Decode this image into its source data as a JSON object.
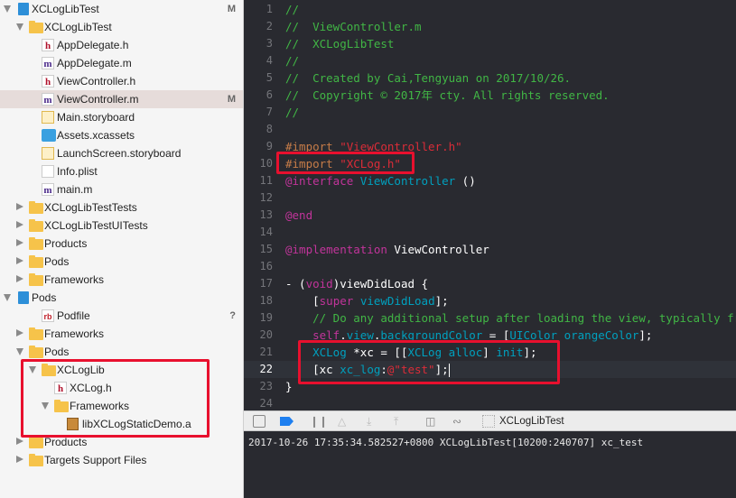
{
  "navigator": {
    "items": [
      {
        "label": "XCLogLibTest",
        "level": 0,
        "arrow": "open",
        "icon": "project",
        "badge": "M"
      },
      {
        "label": "XCLogLibTest",
        "level": 1,
        "arrow": "open",
        "icon": "folder"
      },
      {
        "label": "AppDelegate.h",
        "level": 2,
        "icon": "h"
      },
      {
        "label": "AppDelegate.m",
        "level": 2,
        "icon": "m"
      },
      {
        "label": "ViewController.h",
        "level": 2,
        "icon": "h"
      },
      {
        "label": "ViewController.m",
        "level": 2,
        "icon": "m",
        "badge": "M",
        "selected": true
      },
      {
        "label": "Main.storyboard",
        "level": 2,
        "icon": "storyboard"
      },
      {
        "label": "Assets.xcassets",
        "level": 2,
        "icon": "assets"
      },
      {
        "label": "LaunchScreen.storyboard",
        "level": 2,
        "icon": "storyboard"
      },
      {
        "label": "Info.plist",
        "level": 2,
        "icon": "plist"
      },
      {
        "label": "main.m",
        "level": 2,
        "icon": "m"
      },
      {
        "label": "XCLogLibTestTests",
        "level": 1,
        "arrow": "closed",
        "icon": "folder"
      },
      {
        "label": "XCLogLibTestUITests",
        "level": 1,
        "arrow": "closed",
        "icon": "folder"
      },
      {
        "label": "Products",
        "level": 1,
        "arrow": "closed",
        "icon": "folder"
      },
      {
        "label": "Pods",
        "level": 1,
        "arrow": "closed",
        "icon": "folder"
      },
      {
        "label": "Frameworks",
        "level": 1,
        "arrow": "closed",
        "icon": "folder"
      },
      {
        "label": "Pods",
        "level": 0,
        "arrow": "open",
        "icon": "project"
      },
      {
        "label": "Podfile",
        "level": 2,
        "icon": "ruby",
        "badge": "?"
      },
      {
        "label": "Frameworks",
        "level": 1,
        "arrow": "closed",
        "icon": "folder"
      },
      {
        "label": "Pods",
        "level": 1,
        "arrow": "open",
        "icon": "folder"
      },
      {
        "label": "XCLogLib",
        "level": 2,
        "arrow": "open",
        "icon": "folder"
      },
      {
        "label": "XCLog.h",
        "level": 3,
        "icon": "h"
      },
      {
        "label": "Frameworks",
        "level": 3,
        "arrow": "open",
        "icon": "folder"
      },
      {
        "label": "libXCLogStaticDemo.a",
        "level": 4,
        "icon": "library"
      },
      {
        "label": "Products",
        "level": 1,
        "arrow": "closed",
        "icon": "folder"
      },
      {
        "label": "Targets Support Files",
        "level": 1,
        "arrow": "closed",
        "icon": "folder"
      }
    ]
  },
  "editor": {
    "current_line": 22,
    "lines": [
      [
        [
          "comment",
          "//"
        ]
      ],
      [
        [
          "comment",
          "//  ViewController.m"
        ]
      ],
      [
        [
          "comment",
          "//  XCLogLibTest"
        ]
      ],
      [
        [
          "comment",
          "//"
        ]
      ],
      [
        [
          "comment",
          "//  Created by Cai,Tengyuan on 2017/10/26."
        ]
      ],
      [
        [
          "comment",
          "//  Copyright © 2017年 cty. All rights reserved."
        ]
      ],
      [
        [
          "comment",
          "//"
        ]
      ],
      [],
      [
        [
          "pre",
          "#import "
        ],
        [
          "str",
          "\"ViewController.h\""
        ]
      ],
      [
        [
          "pre",
          "#import "
        ],
        [
          "str",
          "\"XCLog.h\""
        ]
      ],
      [
        [
          "kw",
          "@interface "
        ],
        [
          "cls",
          "ViewController"
        ],
        [
          "plain",
          " ()"
        ]
      ],
      [],
      [
        [
          "kw",
          "@end"
        ]
      ],
      [],
      [
        [
          "kw",
          "@implementation "
        ],
        [
          "plain",
          "ViewController"
        ]
      ],
      [],
      [
        [
          "plain",
          "- ("
        ],
        [
          "kw",
          "void"
        ],
        [
          "plain",
          ")viewDidLoad {"
        ]
      ],
      [
        [
          "plain",
          "    ["
        ],
        [
          "kw",
          "super"
        ],
        [
          "plain",
          " "
        ],
        [
          "meth",
          "viewDidLoad"
        ],
        [
          "plain",
          "];"
        ]
      ],
      [
        [
          "comment",
          "    // Do any additional setup after loading the view, typically from a nib."
        ]
      ],
      [
        [
          "plain",
          "    "
        ],
        [
          "kw",
          "self"
        ],
        [
          "plain",
          "."
        ],
        [
          "meth",
          "view"
        ],
        [
          "plain",
          "."
        ],
        [
          "meth",
          "backgroundColor"
        ],
        [
          "plain",
          " = ["
        ],
        [
          "cls",
          "UIColor"
        ],
        [
          "plain",
          " "
        ],
        [
          "meth",
          "orangeColor"
        ],
        [
          "plain",
          "];"
        ]
      ],
      [
        [
          "plain",
          "    "
        ],
        [
          "cls",
          "XCLog"
        ],
        [
          "plain",
          " *xc = [["
        ],
        [
          "cls",
          "XCLog"
        ],
        [
          "plain",
          " "
        ],
        [
          "meth",
          "alloc"
        ],
        [
          "plain",
          "] "
        ],
        [
          "meth",
          "init"
        ],
        [
          "plain",
          "];"
        ]
      ],
      [
        [
          "plain",
          "    [xc "
        ],
        [
          "meth",
          "xc_log"
        ],
        [
          "plain",
          ":"
        ],
        [
          "str",
          "@\"test\""
        ],
        [
          "plain",
          "];"
        ]
      ],
      [
        [
          "plain",
          "}"
        ]
      ],
      []
    ]
  },
  "debug_bar": {
    "target_label": "XCLogLibTest",
    "icons": [
      "hide-debug-area-icon",
      "breakpoints-icon",
      "pause-icon",
      "step-over-icon",
      "step-into-icon",
      "step-out-icon",
      "view-hierarchy-icon",
      "memory-graph-icon",
      "simulate-location-icon"
    ]
  },
  "console": {
    "output": "2017-10-26 17:35:34.582527+0800 XCLogLibTest[10200:240707] xc_test"
  },
  "colors": {
    "highlight_box": "#e8102e",
    "comment": "#41b645",
    "keyword": "#c2349b",
    "string": "#db2c38",
    "preprocessor": "#c67c48",
    "class": "#00a0be",
    "editor_bg": "#292a30"
  }
}
